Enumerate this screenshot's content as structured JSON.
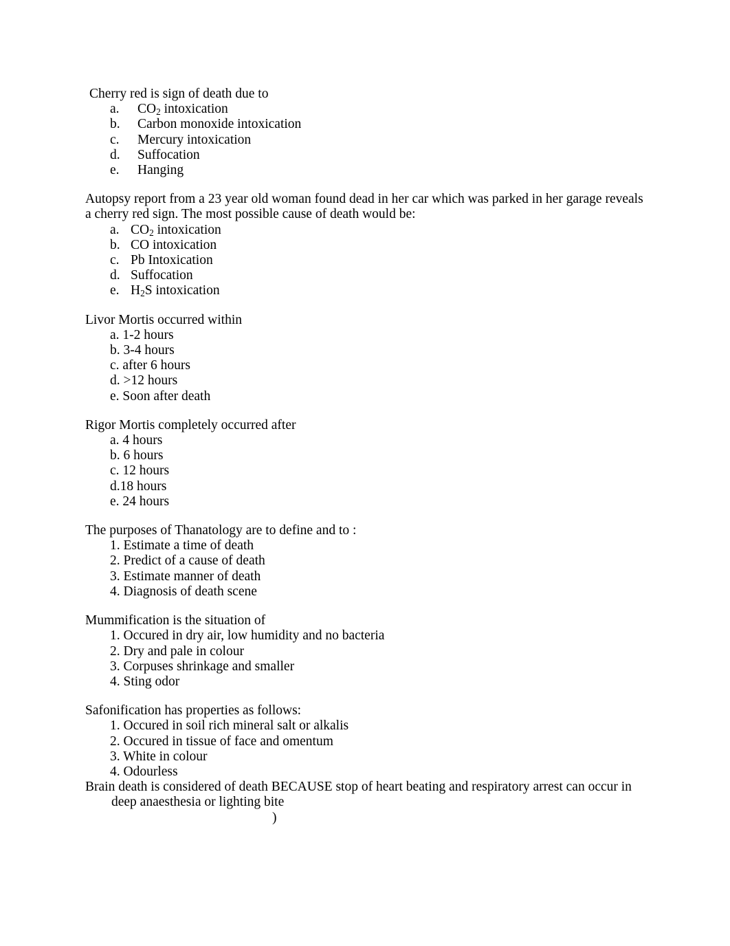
{
  "document": {
    "blocks": [
      {
        "id": "cherry-red-sign",
        "stem": "Cherry red is sign of death due to",
        "list_style": "tabbed",
        "options": [
          {
            "marker": "a.",
            "text_pre": "CO",
            "sub": "2",
            "text_post": " intoxication"
          },
          {
            "marker": "b.",
            "text_pre": "Carbon monoxide intoxication",
            "sub": "",
            "text_post": ""
          },
          {
            "marker": "c.",
            "text_pre": "Mercury intoxication",
            "sub": "",
            "text_post": ""
          },
          {
            "marker": "d.",
            "text_pre": "Suffocation",
            "sub": "",
            "text_post": ""
          },
          {
            "marker": "e.",
            "text_pre": "Hanging",
            "sub": "",
            "text_post": ""
          }
        ]
      },
      {
        "id": "autopsy-report-garage",
        "stem": "Autopsy report from a 23 year old woman found dead in her car which was parked in her garage reveals a cherry red sign. The most possible cause of death would be:",
        "list_style": "tabbed-narrow",
        "options": [
          {
            "marker": "a.",
            "text_pre": "CO",
            "sub": "2",
            "text_post": " intoxication"
          },
          {
            "marker": "b.",
            "text_pre": "CO intoxication",
            "sub": "",
            "text_post": ""
          },
          {
            "marker": "c.",
            "text_pre": "Pb Intoxication",
            "sub": "",
            "text_post": ""
          },
          {
            "marker": "d.",
            "text_pre": "Suffocation",
            "sub": "",
            "text_post": ""
          },
          {
            "marker": "e.",
            "text_pre": "H",
            "sub": "2",
            "text_post": "S intoxication"
          }
        ]
      },
      {
        "id": "livor-mortis",
        "stem": "Livor Mortis occurred within",
        "list_style": "inline-marker",
        "options": [
          {
            "marker": "",
            "text_pre": "a. 1-2 hours",
            "sub": "",
            "text_post": ""
          },
          {
            "marker": "",
            "text_pre": "b. 3-4 hours",
            "sub": "",
            "text_post": ""
          },
          {
            "marker": "",
            "text_pre": "c. after 6 hours",
            "sub": "",
            "text_post": ""
          },
          {
            "marker": "",
            "text_pre": "d. >12 hours",
            "sub": "",
            "text_post": ""
          },
          {
            "marker": "",
            "text_pre": "e. Soon after death",
            "sub": "",
            "text_post": ""
          }
        ]
      },
      {
        "id": "rigor-mortis",
        "stem": "Rigor Mortis completely occurred after",
        "list_style": "inline-marker",
        "options": [
          {
            "marker": "",
            "text_pre": "a. 4 hours",
            "sub": "",
            "text_post": ""
          },
          {
            "marker": "",
            "text_pre": "b. 6 hours",
            "sub": "",
            "text_post": ""
          },
          {
            "marker": "",
            "text_pre": "c. 12 hours",
            "sub": "",
            "text_post": ""
          },
          {
            "marker": "",
            "text_pre": "d.18 hours",
            "sub": "",
            "text_post": ""
          },
          {
            "marker": "",
            "text_pre": "e. 24 hours",
            "sub": "",
            "text_post": ""
          }
        ]
      },
      {
        "id": "thanatology-purposes",
        "stem": "The purposes of Thanatology are to define and to :",
        "list_style": "inline-marker",
        "options": [
          {
            "marker": "",
            "text_pre": "1. Estimate a time of death",
            "sub": "",
            "text_post": ""
          },
          {
            "marker": "",
            "text_pre": "2. Predict of a cause of death",
            "sub": "",
            "text_post": ""
          },
          {
            "marker": "",
            "text_pre": "3. Estimate manner of death",
            "sub": "",
            "text_post": ""
          },
          {
            "marker": "",
            "text_pre": "4. Diagnosis of death scene",
            "sub": "",
            "text_post": ""
          }
        ]
      },
      {
        "id": "mummification",
        "stem": "Mummification is the situation of",
        "list_style": "inline-marker",
        "options": [
          {
            "marker": "",
            "text_pre": "1. Occured in dry air, low humidity and no bacteria",
            "sub": "",
            "text_post": ""
          },
          {
            "marker": "",
            "text_pre": "2. Dry and pale in colour",
            "sub": "",
            "text_post": ""
          },
          {
            "marker": "",
            "text_pre": "3. Corpuses shrinkage and smaller",
            "sub": "",
            "text_post": ""
          },
          {
            "marker": "",
            "text_pre": "4. Sting odor",
            "sub": "",
            "text_post": ""
          }
        ]
      },
      {
        "id": "safonification",
        "stem": "Safonification has properties as follows:",
        "list_style": "inline-marker",
        "options": [
          {
            "marker": "",
            "text_pre": "1. Occured in soil rich mineral salt or alkalis",
            "sub": "",
            "text_post": ""
          },
          {
            "marker": "",
            "text_pre": "2. Occured in tissue of face and omentum",
            "sub": "",
            "text_post": ""
          },
          {
            "marker": "",
            "text_pre": "3. White in colour",
            "sub": "",
            "text_post": ""
          },
          {
            "marker": "",
            "text_pre": "4. Odourless",
            "sub": "",
            "text_post": ""
          }
        ]
      }
    ],
    "final_block": {
      "id": "brain-death-because",
      "line_1": "Brain death is considered of death BECAUSE stop of heart beating and respiratory arrest can occur in",
      "line_2": "deep anaesthesia or lighting bite",
      "stray_mark": ")"
    }
  }
}
